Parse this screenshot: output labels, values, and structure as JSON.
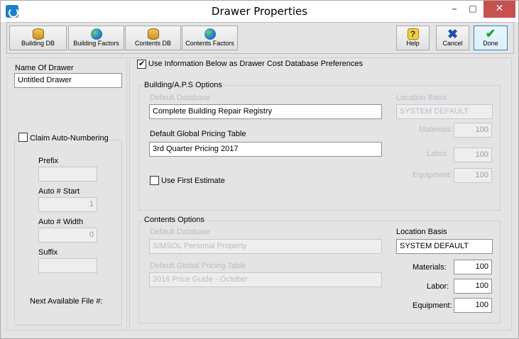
{
  "window": {
    "title": "Drawer Properties"
  },
  "toolbar": {
    "building_db": "Building DB",
    "building_factors": "Building Factors",
    "contents_db": "Contents DB",
    "contents_factors": "Contents Factors",
    "help": "Help",
    "cancel": "Cancel",
    "done": "Done"
  },
  "left": {
    "name_label": "Name Of Drawer",
    "name_value": "Untitled Drawer",
    "claim_label": "Claim Auto-Numbering",
    "claim_checked": false,
    "prefix_label": "Prefix",
    "prefix_value": "",
    "auto_start_label": "Auto # Start",
    "auto_start_value": "1",
    "auto_width_label": "Auto # Width",
    "auto_width_value": "0",
    "suffix_label": "Suffix",
    "suffix_value": "",
    "next_file_label": "Next Available File #:"
  },
  "right": {
    "use_info_label": "Use Information Below as Drawer Cost Database Preferences",
    "use_info_checked": true,
    "building": {
      "title": "Building/A.P.S Options",
      "default_db_label": "Default Database",
      "default_db_value": "Complete Building Repair Registry",
      "pricing_label": "Default Global Pricing Table",
      "pricing_value": "3rd Quarter Pricing 2017",
      "use_first_label": "Use First Estimate",
      "use_first_checked": false,
      "location_label": "Location Basis",
      "location_value": "SYSTEM DEFAULT",
      "materials_label": "Materials:",
      "materials_value": "100",
      "labor_label": "Labor:",
      "labor_value": "100",
      "equipment_label": "Equipment:",
      "equipment_value": "100"
    },
    "contents": {
      "title": "Contents Options",
      "default_db_label": "Default Database",
      "default_db_value": "SIMSOL Personal Property",
      "pricing_label": "Default Global Pricing Table",
      "pricing_value": "2016 Price Guide - October",
      "location_label": "Location Basis",
      "location_value": "SYSTEM DEFAULT",
      "materials_label": "Materials:",
      "materials_value": "100",
      "labor_label": "Labor:",
      "labor_value": "100",
      "equipment_label": "Equipment:",
      "equipment_value": "100"
    }
  }
}
